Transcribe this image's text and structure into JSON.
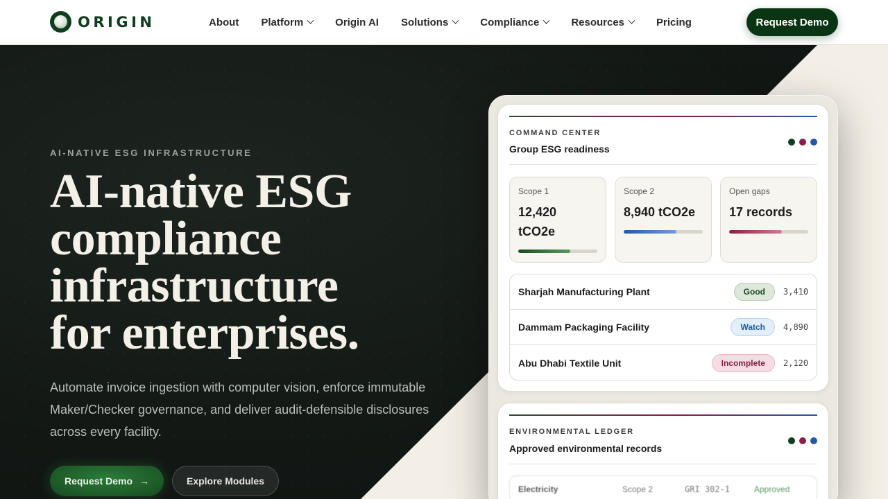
{
  "brand": {
    "name": "ORIGIN"
  },
  "nav": {
    "items": [
      {
        "label": "About",
        "dropdown": false
      },
      {
        "label": "Platform",
        "dropdown": true
      },
      {
        "label": "Origin AI",
        "dropdown": false
      },
      {
        "label": "Solutions",
        "dropdown": true
      },
      {
        "label": "Compliance",
        "dropdown": true
      },
      {
        "label": "Resources",
        "dropdown": true
      },
      {
        "label": "Pricing",
        "dropdown": false
      }
    ],
    "cta": "Request Demo"
  },
  "hero": {
    "eyebrow": "AI-NATIVE ESG INFRASTRUCTURE",
    "headline": [
      "AI-native ESG",
      "compliance",
      "infrastructure",
      "for enterprises."
    ],
    "subheading": "Automate invoice ingestion with computer vision, enforce immutable Maker/Checker governance, and deliver audit-defensible disclosures across every facility.",
    "primary_cta": "Request Demo",
    "secondary_cta": "Explore Modules"
  },
  "command_center": {
    "kicker": "COMMAND CENTER",
    "title": "Group ESG readiness",
    "dot_colors": [
      "#0f3d1f",
      "#8a1e47",
      "#2459a6"
    ],
    "stats": [
      {
        "label": "Scope 1",
        "value": "12,420 tCO2e",
        "progress": 0.66,
        "color_from": "#1a4a22",
        "color_to": "#5a9a62"
      },
      {
        "label": "Scope 2",
        "value": "8,940 tCO2e",
        "progress": 0.67,
        "color_from": "#2459a6",
        "color_to": "#6fa0d8"
      },
      {
        "label": "Open gaps",
        "value": "17 records",
        "progress": 0.67,
        "color_from": "#8a1e47",
        "color_to": "#d07a98"
      }
    ],
    "facilities": [
      {
        "name": "Sharjah Manufacturing Plant",
        "status": "Good",
        "value": "3,410",
        "badge_bg": "#dde8db",
        "badge_fg": "#1d4a24",
        "badge_border": "#b6cdb3"
      },
      {
        "name": "Dammam Packaging Facility",
        "status": "Watch",
        "value": "4,890",
        "badge_bg": "#e2eef9",
        "badge_fg": "#1f5a9e",
        "badge_border": "#b8d3ef"
      },
      {
        "name": "Abu Dhabi Textile Unit",
        "status": "Incomplete",
        "value": "2,120",
        "badge_bg": "#f6dde4",
        "badge_fg": "#8a1e47",
        "badge_border": "#e8b6c6"
      }
    ]
  },
  "ledger": {
    "kicker": "ENVIRONMENTAL LEDGER",
    "title": "Approved environmental records",
    "dot_colors": [
      "#0f3d1f",
      "#8a1e47",
      "#2459a6"
    ],
    "row": {
      "type": "Electricity",
      "scope": "Scope 2",
      "gri": "GRI 302-1",
      "status": "Approved"
    }
  }
}
